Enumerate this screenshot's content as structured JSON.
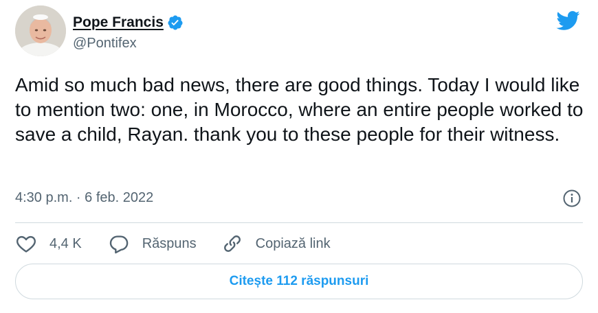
{
  "author": {
    "display_name": "Pope Francis",
    "handle": "@Pontifex",
    "verified": true,
    "avatar": "avatar-photo"
  },
  "brand": {
    "icon": "twitter-bird-icon",
    "color": "#1d9bf0"
  },
  "tweet": {
    "text": "Amid so much bad news, there are good things. Today I would like to mention two: one, in Morocco, where an entire people worked to save a child, Rayan. thank you to these people for their witness.",
    "timestamp": "4:30 p.m. · 6 feb. 2022"
  },
  "actions": {
    "like_count": "4,4 K",
    "reply_label": "Răspuns",
    "copy_link_label": "Copiază link"
  },
  "read_replies_label": "Citește 112 răspunsuri",
  "colors": {
    "text": "#0f1419",
    "secondary": "#536471",
    "accent": "#1d9bf0",
    "border": "#cfd9de"
  }
}
